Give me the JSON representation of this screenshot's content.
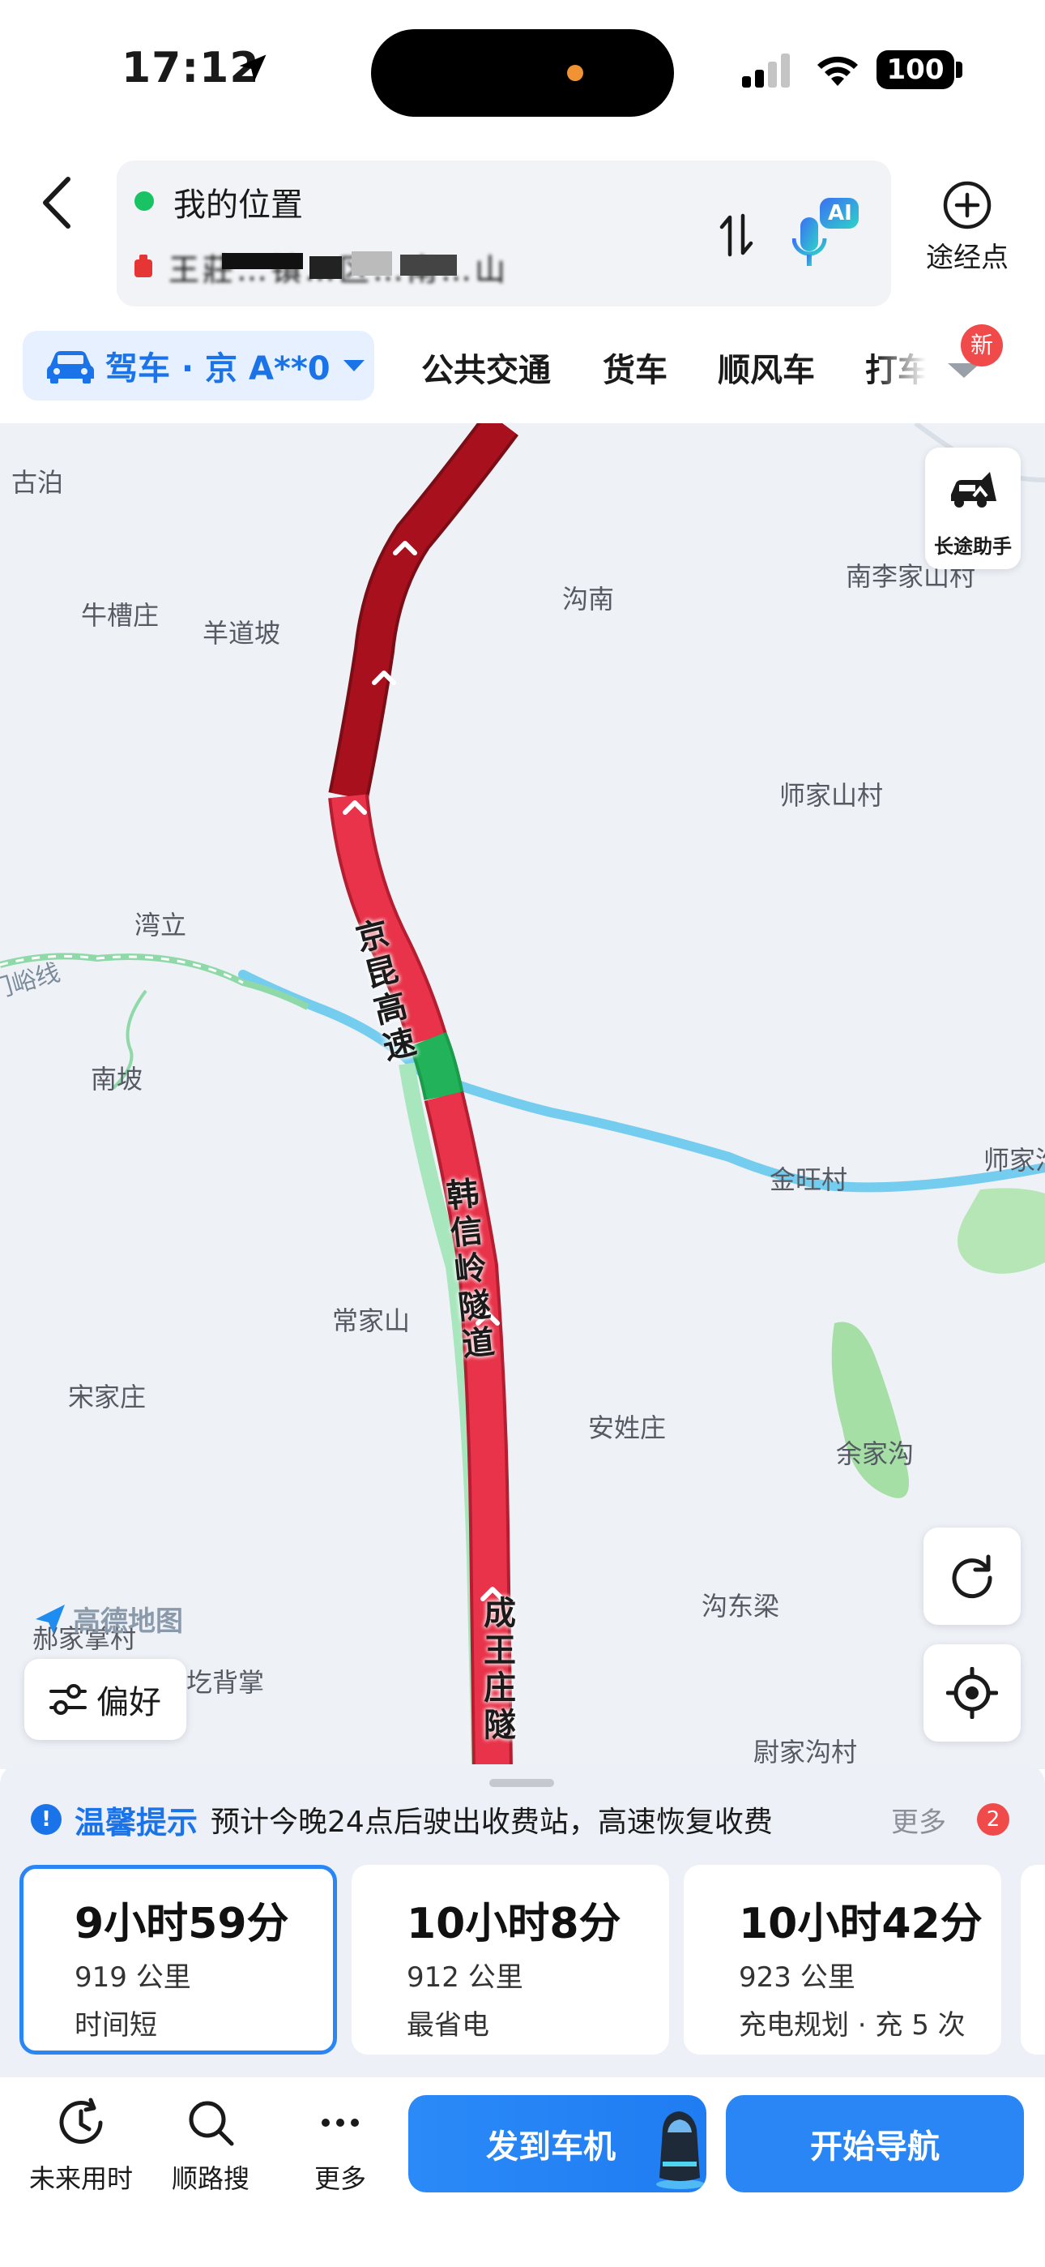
{
  "status_bar": {
    "time": "17:12",
    "battery": "100"
  },
  "header": {
    "origin": "我的位置",
    "destination": "王莊…镇…区…南…山",
    "waypoint_label": "途经点",
    "ai_label": "AI"
  },
  "tabs": {
    "drive_label": "驾车 · 京 A**0",
    "items": [
      "公共交通",
      "货车",
      "顺风车",
      "打车"
    ],
    "new_badge": "新"
  },
  "map": {
    "assistant_label": "长途助手",
    "preference_label": "偏好",
    "logo_text": "高德地图",
    "rail_label": "门峪线",
    "road_labels": [
      "京昆高速",
      "韩信岭隧道",
      "成王庄隧"
    ],
    "places": [
      "古泊",
      "牛槽庄",
      "羊道坡",
      "沟南",
      "南李家山村",
      "师家山村",
      "湾立",
      "南坡",
      "金旺村",
      "师家沟",
      "常家山",
      "宋家庄",
      "安姓庄",
      "余家沟",
      "沟东梁",
      "郝家掌村",
      "圪背掌",
      "尉家沟村"
    ]
  },
  "notice": {
    "icon": "!",
    "title": "温馨提示",
    "text": "预计今晚24点后驶出收费站，高速恢复收费",
    "more": "更多",
    "count": "2"
  },
  "routes": [
    {
      "time": "9小时59分",
      "distance": "919 公里",
      "tag": "时间短",
      "selected": true
    },
    {
      "time": "10小时8分",
      "distance": "912 公里",
      "tag": "最省电",
      "selected": false
    },
    {
      "time": "10小时42分",
      "distance": "923 公里",
      "tag": "充电规划 · 充 5 次",
      "selected": false
    }
  ],
  "bottom_bar": {
    "future_label": "未来用时",
    "search_label": "顺路搜",
    "more_label": "更多",
    "send_label": "发到车机",
    "nav_label": "开始导航"
  },
  "colors": {
    "accent": "#1a73e8",
    "congestion_heavy": "#a8101e",
    "congestion": "#e8334a",
    "smooth": "#22b35a",
    "water": "#74ccee"
  }
}
